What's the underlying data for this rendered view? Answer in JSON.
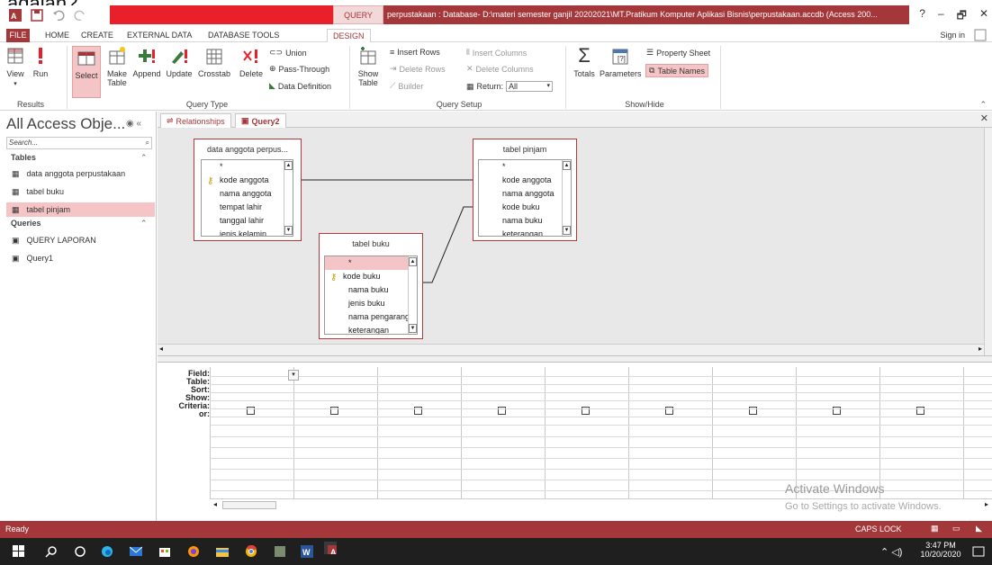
{
  "top_cut_text": "adalah?",
  "titlebar": {
    "context_tab": "QUERY TOOLS",
    "title": "perpustakaan : Database- D:\\materi semester ganjil 20202021\\MT.Pratikum Komputer Aplikasi Bisnis\\perpustakaan.accdb (Access 200...",
    "help": "?",
    "minimize": "–",
    "restore": "🗗",
    "close": "✕"
  },
  "tabs": [
    "FILE",
    "HOME",
    "CREATE",
    "EXTERNAL DATA",
    "DATABASE TOOLS",
    "DESIGN"
  ],
  "signin": "Sign in",
  "ribbon": {
    "results": {
      "label": "Results",
      "view": "View",
      "run": "Run"
    },
    "query_type": {
      "label": "Query Type",
      "select": "Select",
      "make_table_1": "Make",
      "make_table_2": "Table",
      "append": "Append",
      "update": "Update",
      "crosstab": "Crosstab",
      "delete": "Delete",
      "union": "Union",
      "pass_through": "Pass-Through",
      "data_definition": "Data Definition"
    },
    "query_setup": {
      "label": "Query Setup",
      "show_table_1": "Show",
      "show_table_2": "Table",
      "insert_rows": "Insert Rows",
      "delete_rows": "Delete Rows",
      "builder": "Builder",
      "insert_columns": "Insert Columns",
      "delete_columns": "Delete Columns",
      "return_label": "Return:",
      "return_value": "All"
    },
    "show_hide": {
      "label": "Show/Hide",
      "totals": "Totals",
      "parameters": "Parameters",
      "property_sheet": "Property Sheet",
      "table_names": "Table Names"
    }
  },
  "nav": {
    "title": "All Access Obje...",
    "search_placeholder": "Search...",
    "tables_header": "Tables",
    "tables": [
      "data anggota perpustakaan",
      "tabel buku",
      "tabel pinjam"
    ],
    "queries_header": "Queries",
    "queries": [
      "QUERY LAPORAN",
      "Query1"
    ]
  },
  "doc_tabs": [
    "Relationships",
    "Query2"
  ],
  "design_tables": {
    "anggota": {
      "title": "data anggota perpus...",
      "fields": [
        "*",
        "kode anggota",
        "nama anggota",
        "tempat lahir",
        "tanggal lahir",
        "jenis kelamin"
      ]
    },
    "pinjam": {
      "title": "tabel pinjam",
      "fields": [
        "*",
        "kode anggota",
        "nama anggota",
        "kode buku",
        "nama buku",
        "keterangan"
      ]
    },
    "buku": {
      "title": "tabel buku",
      "fields": [
        "*",
        "kode buku",
        "nama buku",
        "jenis buku",
        "nama pengarang",
        "keterangan"
      ]
    }
  },
  "grid": {
    "row_labels": [
      "Field:",
      "Table:",
      "Sort:",
      "Show:",
      "Criteria:",
      "or:"
    ]
  },
  "watermark": {
    "line1": "Activate Windows",
    "line2": "Go to Settings to activate Windows."
  },
  "status": {
    "left": "Ready",
    "caps": "CAPS LOCK"
  },
  "taskbar": {
    "time": "3:47 PM",
    "date": "10/20/2020"
  },
  "colors": {
    "accent": "#a4373a",
    "highlight": "#f4c4c6",
    "title_red": "#e8202a"
  }
}
